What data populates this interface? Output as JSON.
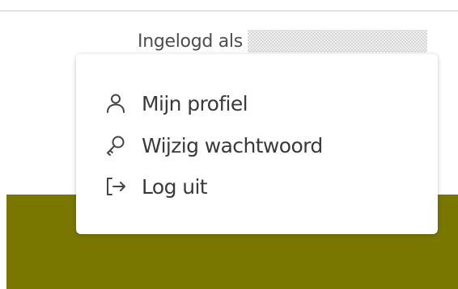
{
  "header": {
    "logged_in_label": "Ingelogd als"
  },
  "user_menu": {
    "items": [
      {
        "label": "Mijn profiel",
        "icon": "user-icon"
      },
      {
        "label": "Wijzig wachtwoord",
        "icon": "key-icon"
      },
      {
        "label": "Log uit",
        "icon": "logout-icon"
      }
    ]
  },
  "colors": {
    "band": "#7a7700",
    "text": "#3a3a3a"
  }
}
